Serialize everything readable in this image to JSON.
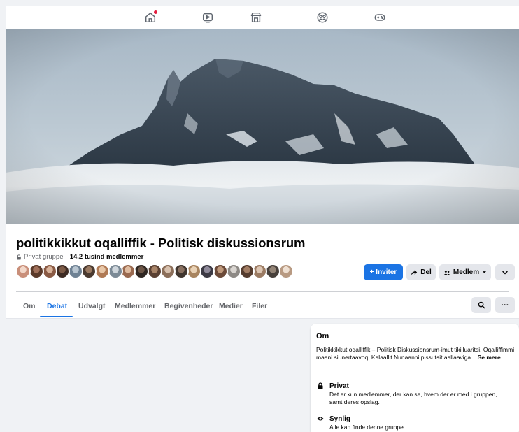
{
  "nav": {
    "items": [
      {
        "name": "home",
        "icon": "home-icon",
        "has_notification": true
      },
      {
        "name": "watch",
        "icon": "video-icon"
      },
      {
        "name": "marketplace",
        "icon": "marketplace-icon"
      },
      {
        "name": "groups",
        "icon": "groups-icon"
      },
      {
        "name": "gaming",
        "icon": "gaming-icon"
      }
    ]
  },
  "group": {
    "title": "politikkikkut oqalliffik - Politisk diskussionsrum",
    "privacy": "Privat gruppe",
    "separator": "·",
    "members": "14,2 tusind medlemmer"
  },
  "actions": {
    "invite": "+ Inviter",
    "share": "Del",
    "member": "Medlem",
    "more_icon": "chevron-down-icon"
  },
  "tabs": [
    "Om",
    "Debat",
    "Udvalgt",
    "Medlemmer",
    "Begivenheder",
    "Medier",
    "Filer"
  ],
  "active_tab": "Debat",
  "tools": {
    "search_icon": "search-icon",
    "more_label": "···"
  },
  "about": {
    "title": "Om",
    "description": "Politikkikkut oqalliffik – Politisk Diskussionsrum-imut tikilluaritsi. Oqalliffimmi maani siunertaavoq, Kalaallit Nunaanni pissutsit aallaaviga...",
    "see_more": "Se mere",
    "privacy_title": "Privat",
    "privacy_text": "Det er kun medlemmer, der kan se, hvem der er med i gruppen, samt deres opslag.",
    "visibility_title": "Synlig",
    "visibility_text": "Alle kan finde denne gruppe."
  },
  "colors": {
    "accent": "#1b74e4",
    "notification": "#e41e3f"
  }
}
